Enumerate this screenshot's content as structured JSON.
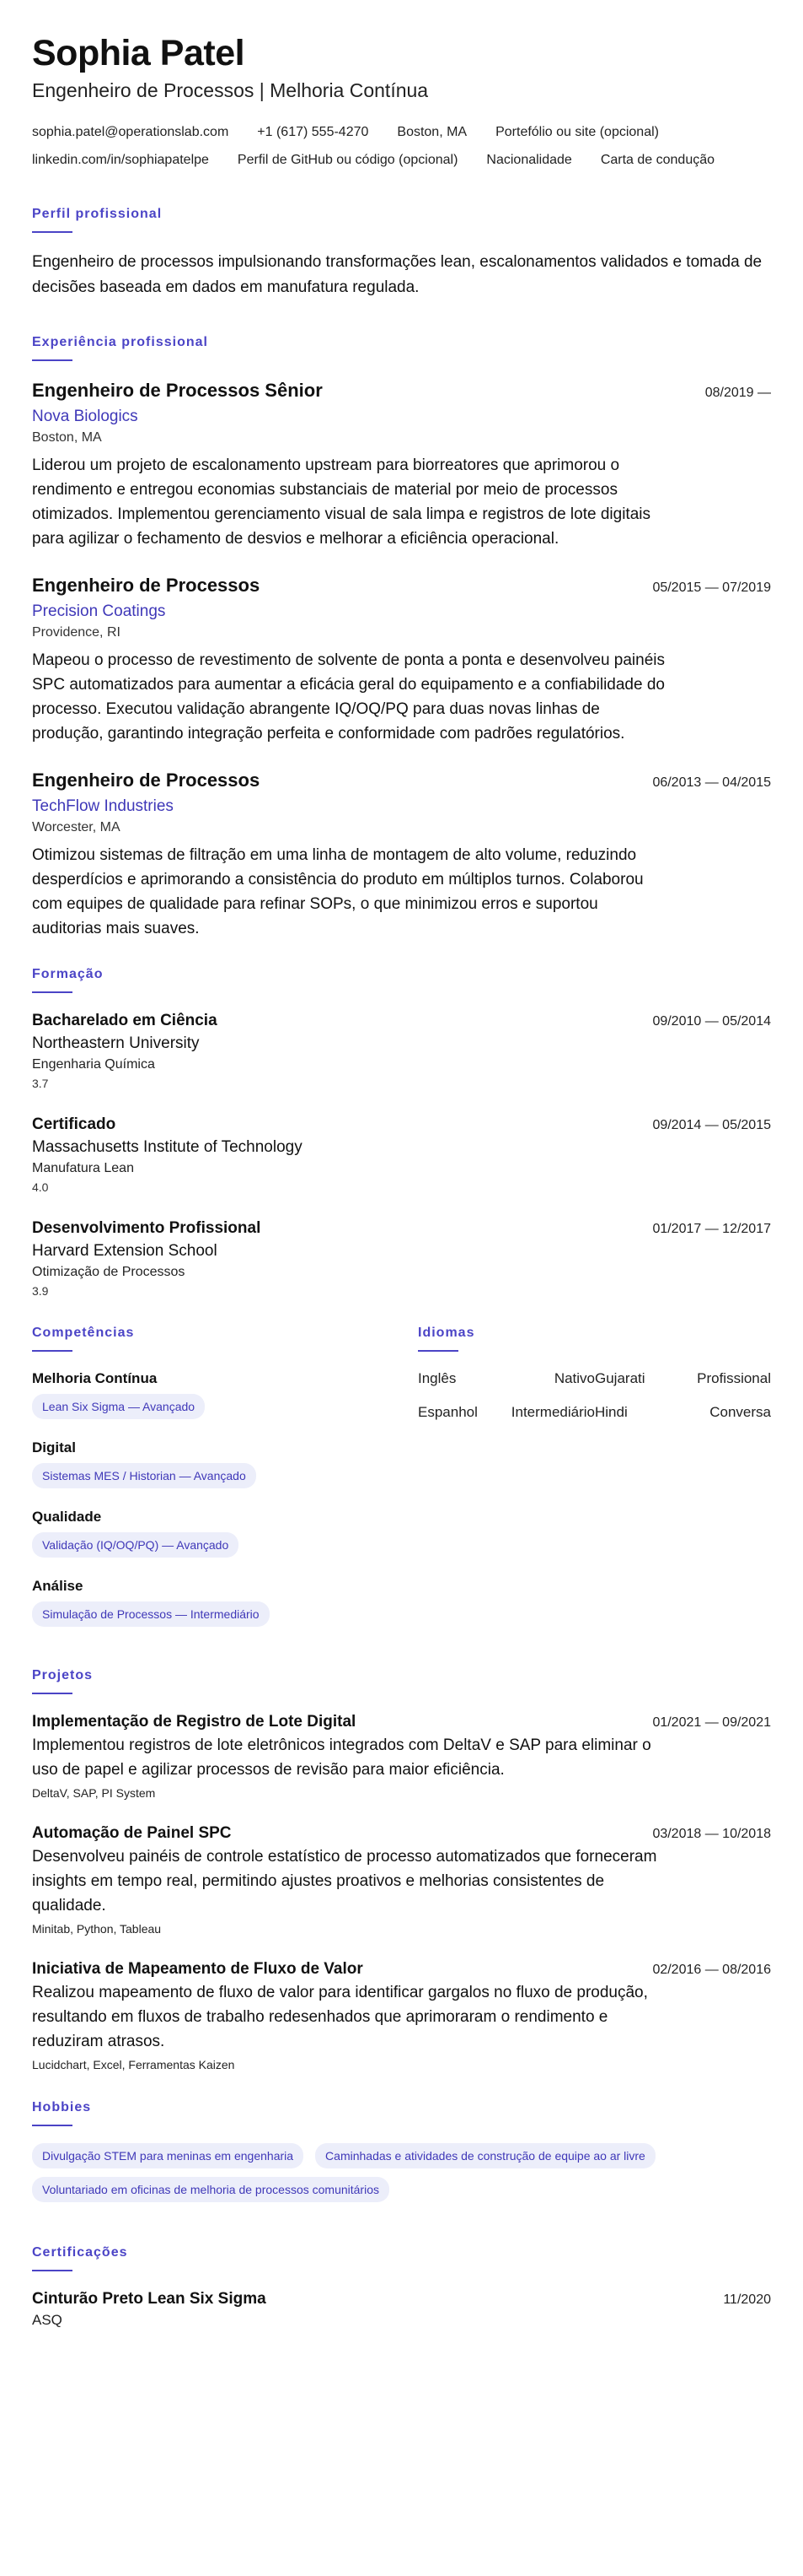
{
  "header": {
    "name": "Sophia Patel",
    "headline": "Engenheiro de Processos | Melhoria Contínua",
    "contacts": [
      "sophia.patel@operationslab.com",
      "+1 (617) 555-4270",
      "Boston, MA",
      "Portefólio ou site (opcional)",
      "linkedin.com/in/sophiapatelpe",
      "Perfil de GitHub ou código (opcional)",
      "Nacionalidade",
      "Carta de condução"
    ]
  },
  "summary": {
    "title": "Perfil profissional",
    "text": "Engenheiro de processos impulsionando transformações lean, escalonamentos validados e tomada de decisões baseada em dados em manufatura regulada."
  },
  "experience": {
    "title": "Experiência profissional",
    "items": [
      {
        "title": "Engenheiro de Processos Sênior",
        "company": "Nova Biologics",
        "location": "Boston, MA",
        "dates": "08/2019 —",
        "description": "Liderou um projeto de escalonamento upstream para biorreatores que aprimorou o rendimento e entregou economias substanciais de material por meio de processos otimizados. Implementou gerenciamento visual de sala limpa e registros de lote digitais para agilizar o fechamento de desvios e melhorar a eficiência operacional."
      },
      {
        "title": "Engenheiro de Processos",
        "company": "Precision Coatings",
        "location": "Providence, RI",
        "dates": "05/2015 — 07/2019",
        "description": "Mapeou o processo de revestimento de solvente de ponta a ponta e desenvolveu painéis SPC automatizados para aumentar a eficácia geral do equipamento e a confiabilidade do processo. Executou validação abrangente IQ/OQ/PQ para duas novas linhas de produção, garantindo integração perfeita e conformidade com padrões regulatórios."
      },
      {
        "title": "Engenheiro de Processos",
        "company": "TechFlow Industries",
        "location": "Worcester, MA",
        "dates": "06/2013 — 04/2015",
        "description": "Otimizou sistemas de filtração em uma linha de montagem de alto volume, reduzindo desperdícios e aprimorando a consistência do produto em múltiplos turnos. Colaborou com equipes de qualidade para refinar SOPs, o que minimizou erros e suportou auditorias mais suaves."
      }
    ]
  },
  "education": {
    "title": "Formação",
    "items": [
      {
        "degree": "Bacharelado em Ciência",
        "school": "Northeastern University",
        "field": "Engenharia Química",
        "score": "3.7",
        "dates": "09/2010 — 05/2014"
      },
      {
        "degree": "Certificado",
        "school": "Massachusetts Institute of Technology",
        "field": "Manufatura Lean",
        "score": "4.0",
        "dates": "09/2014 — 05/2015"
      },
      {
        "degree": "Desenvolvimento Profissional",
        "school": "Harvard Extension School",
        "field": "Otimização de Processos",
        "score": "3.9",
        "dates": "01/2017 — 12/2017"
      }
    ]
  },
  "skills": {
    "title": "Competências",
    "groups": [
      {
        "name": "Melhoria Contínua",
        "chip": "Lean Six Sigma — Avançado"
      },
      {
        "name": "Digital",
        "chip": "Sistemas MES / Historian — Avançado"
      },
      {
        "name": "Qualidade",
        "chip": "Validação (IQ/OQ/PQ) — Avançado"
      },
      {
        "name": "Análise",
        "chip": "Simulação de Processos — Intermediário"
      }
    ]
  },
  "languages": {
    "title": "Idiomas",
    "items": [
      {
        "name": "Inglês",
        "level": "Nativo"
      },
      {
        "name": "Gujarati",
        "level": "Profissional"
      },
      {
        "name": "Espanhol",
        "level": "Intermediário"
      },
      {
        "name": "Hindi",
        "level": "Conversa"
      }
    ]
  },
  "projects": {
    "title": "Projetos",
    "items": [
      {
        "title": "Implementação de Registro de Lote Digital",
        "dates": "01/2021 — 09/2021",
        "description": "Implementou registros de lote eletrônicos integrados com DeltaV e SAP para eliminar o uso de papel e agilizar processos de revisão para maior eficiência.",
        "tech": "DeltaV, SAP, PI System"
      },
      {
        "title": "Automação de Painel SPC",
        "dates": "03/2018 — 10/2018",
        "description": "Desenvolveu painéis de controle estatístico de processo automatizados que forneceram insights em tempo real, permitindo ajustes proativos e melhorias consistentes de qualidade.",
        "tech": "Minitab, Python, Tableau"
      },
      {
        "title": "Iniciativa de Mapeamento de Fluxo de Valor",
        "dates": "02/2016 — 08/2016",
        "description": "Realizou mapeamento de fluxo de valor para identificar gargalos no fluxo de produção, resultando em fluxos de trabalho redesenhados que aprimoraram o rendimento e reduziram atrasos.",
        "tech": "Lucidchart, Excel, Ferramentas Kaizen"
      }
    ]
  },
  "hobbies": {
    "title": "Hobbies",
    "items": [
      "Divulgação STEM para meninas em engenharia",
      "Caminhadas e atividades de construção de equipe ao ar livre",
      "Voluntariado em oficinas de melhoria de processos comunitários"
    ]
  },
  "certifications": {
    "title": "Certificações",
    "items": [
      {
        "title": "Cinturão Preto Lean Six Sigma",
        "issuer": "ASQ",
        "date": "11/2020"
      }
    ]
  },
  "colors": {
    "accent": "#4b44c6",
    "chip_bg": "#eceefa"
  }
}
